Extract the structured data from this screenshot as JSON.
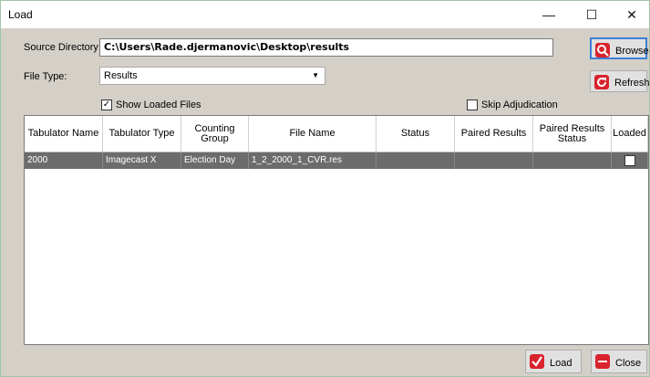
{
  "window": {
    "title": "Load",
    "controls": {
      "minimize": "—",
      "maximize": "☐",
      "close": "✕"
    }
  },
  "form": {
    "source_directory_label": "Source Directory:",
    "source_directory_value": "C:\\Users\\Rade.djermanovic\\Desktop\\results",
    "file_type_label": "File Type:",
    "file_type_value": "Results",
    "show_loaded_files_label": "Show Loaded Files",
    "show_loaded_files_checked": true,
    "skip_adjudication_label": "Skip Adjudication",
    "skip_adjudication_checked": false
  },
  "buttons": {
    "browse": "Browse",
    "refresh": "Refresh",
    "load": "Load",
    "close": "Close"
  },
  "table": {
    "columns": [
      "Tabulator Name",
      "Tabulator Type",
      "Counting Group",
      "File Name",
      "Status",
      "Paired Results",
      "Paired Results Status",
      "Loaded"
    ],
    "rows": [
      {
        "tabulator_name": "2000",
        "tabulator_type": "Imagecast X",
        "counting_group": "Election Day",
        "file_name": "1_2_2000_1_CVR.res",
        "status": "",
        "paired_results": "",
        "paired_results_status": "",
        "loaded": false
      }
    ]
  },
  "colors": {
    "row_selected_bg": "#6c6c6c",
    "browse_icon": "#d9232d",
    "refresh_icon": "#d9232d",
    "load_icon": "#d9232d",
    "close_icon": "#d9232d",
    "focus_border": "#3c7fd6"
  }
}
